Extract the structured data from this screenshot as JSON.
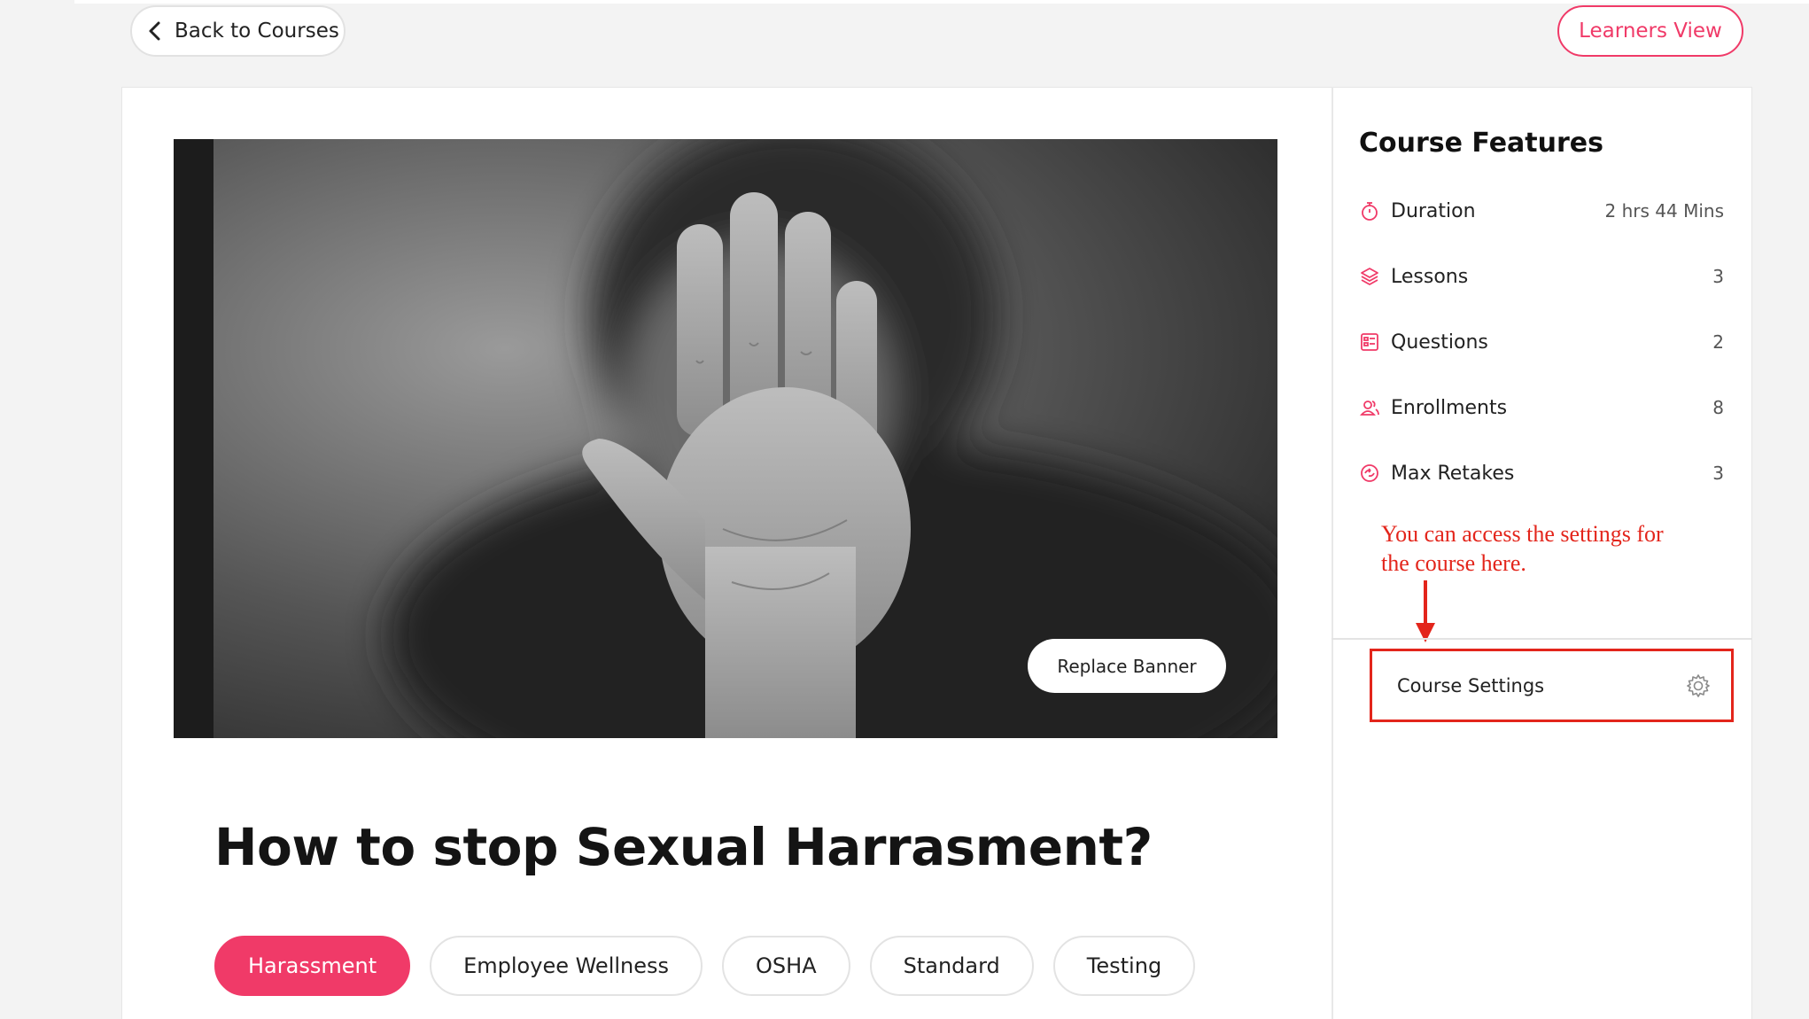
{
  "header": {
    "back_label": "Back to Courses",
    "learners_view_label": "Learners View"
  },
  "banner": {
    "replace_label": "Replace Banner"
  },
  "course": {
    "title": "How to stop Sexual Harrasment?",
    "tags": [
      {
        "label": "Harassment",
        "active": true
      },
      {
        "label": "Employee Wellness",
        "active": false
      },
      {
        "label": "OSHA",
        "active": false
      },
      {
        "label": "Standard",
        "active": false
      },
      {
        "label": "Testing",
        "active": false
      }
    ]
  },
  "features": {
    "title": "Course Features",
    "items": [
      {
        "icon": "stopwatch-icon",
        "label": "Duration",
        "value": "2 hrs 44 Mins"
      },
      {
        "icon": "layers-icon",
        "label": "Lessons",
        "value": "3"
      },
      {
        "icon": "question-list-icon",
        "label": "Questions",
        "value": "2"
      },
      {
        "icon": "users-icon",
        "label": "Enrollments",
        "value": "8"
      },
      {
        "icon": "retake-icon",
        "label": "Max Retakes",
        "value": "3"
      }
    ]
  },
  "annotation": {
    "note": "You can access the settings for the course here."
  },
  "settings": {
    "label": "Course Settings",
    "icon": "gear-icon"
  },
  "colors": {
    "accent": "#f03a68",
    "annotation_red": "#e3251b"
  }
}
